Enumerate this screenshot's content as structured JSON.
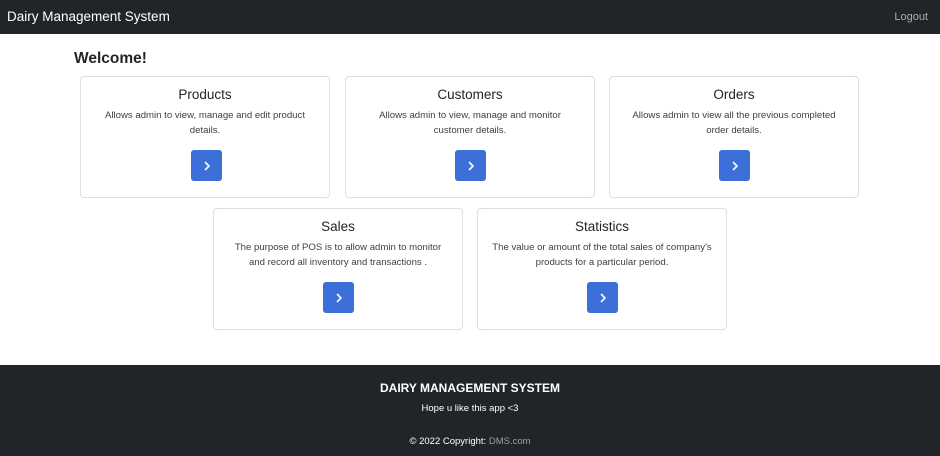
{
  "navbar": {
    "brand": "Dairy Management System",
    "logout": "Logout"
  },
  "welcome": "Welcome!",
  "cards": [
    {
      "title": "Products",
      "line1": "Allows admin to view, manage and edit product",
      "line2": "details.",
      "button_icon": "chevron-right-icon"
    },
    {
      "title": "Customers",
      "line1": "Allows admin to view, manage and monitor",
      "line2": "customer details.",
      "button_icon": "chevron-right-icon"
    },
    {
      "title": "Orders",
      "line1": "Allows admin to view all the previous completed",
      "line2": "order details.",
      "button_icon": "chevron-right-icon"
    },
    {
      "title": "Sales",
      "line1": "The purpose of POS is to allow admin to monitor",
      "line2": "and record all inventory and transactions .",
      "button_icon": "chevron-right-icon"
    },
    {
      "title": "Statistics",
      "line1": "The value or amount of the total sales of company's",
      "line2": "products for a particular period.",
      "button_icon": "chevron-right-icon"
    }
  ],
  "footer": {
    "title": "DAIRY MANAGEMENT SYSTEM",
    "subtitle": "Hope u like this app <3",
    "copyright_prefix": "© 2022 Copyright: ",
    "copyright_link": "DMS.com"
  },
  "colors": {
    "navbar_bg": "#212529",
    "button_blue": "#3d6fd9",
    "card_border": "#dcdfe3"
  }
}
